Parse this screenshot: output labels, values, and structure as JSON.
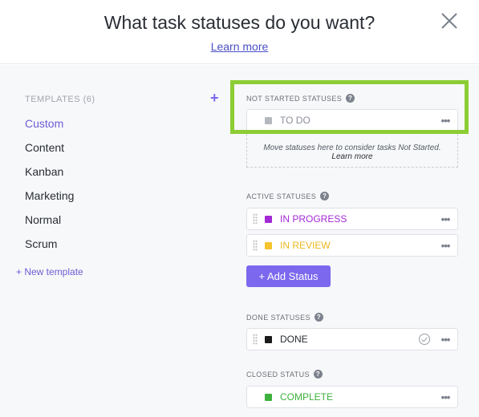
{
  "header": {
    "title": "What task statuses do you want?",
    "learn_more": "Learn more",
    "close_icon": "close-icon"
  },
  "templates": {
    "heading": "TEMPLATES (6)",
    "add_icon": "plus-icon",
    "items": [
      {
        "label": "Custom",
        "active": true
      },
      {
        "label": "Content"
      },
      {
        "label": "Kanban"
      },
      {
        "label": "Marketing"
      },
      {
        "label": "Normal"
      },
      {
        "label": "Scrum"
      }
    ],
    "new_template": "+ New template"
  },
  "not_started": {
    "label": "NOT STARTED STATUSES",
    "statuses": [
      {
        "name": "TO DO",
        "color": "#b5b8be"
      }
    ],
    "drop_hint": "Move statuses here to consider tasks Not Started.",
    "drop_link": "Learn more"
  },
  "active": {
    "label": "ACTIVE STATUSES",
    "statuses": [
      {
        "name": "IN PROGRESS",
        "color": "#a328d6"
      },
      {
        "name": "IN REVIEW",
        "color": "#f5c32c"
      }
    ],
    "add_button": "+ Add Status"
  },
  "done": {
    "label": "DONE STATUSES",
    "statuses": [
      {
        "name": "DONE",
        "color": "#1b1b1b"
      }
    ]
  },
  "closed": {
    "label": "CLOSED STATUS",
    "statuses": [
      {
        "name": "COMPLETE",
        "color": "#3db13d"
      }
    ]
  },
  "colors": {
    "accent": "#7b68ee",
    "highlight": "#8ccd34"
  }
}
